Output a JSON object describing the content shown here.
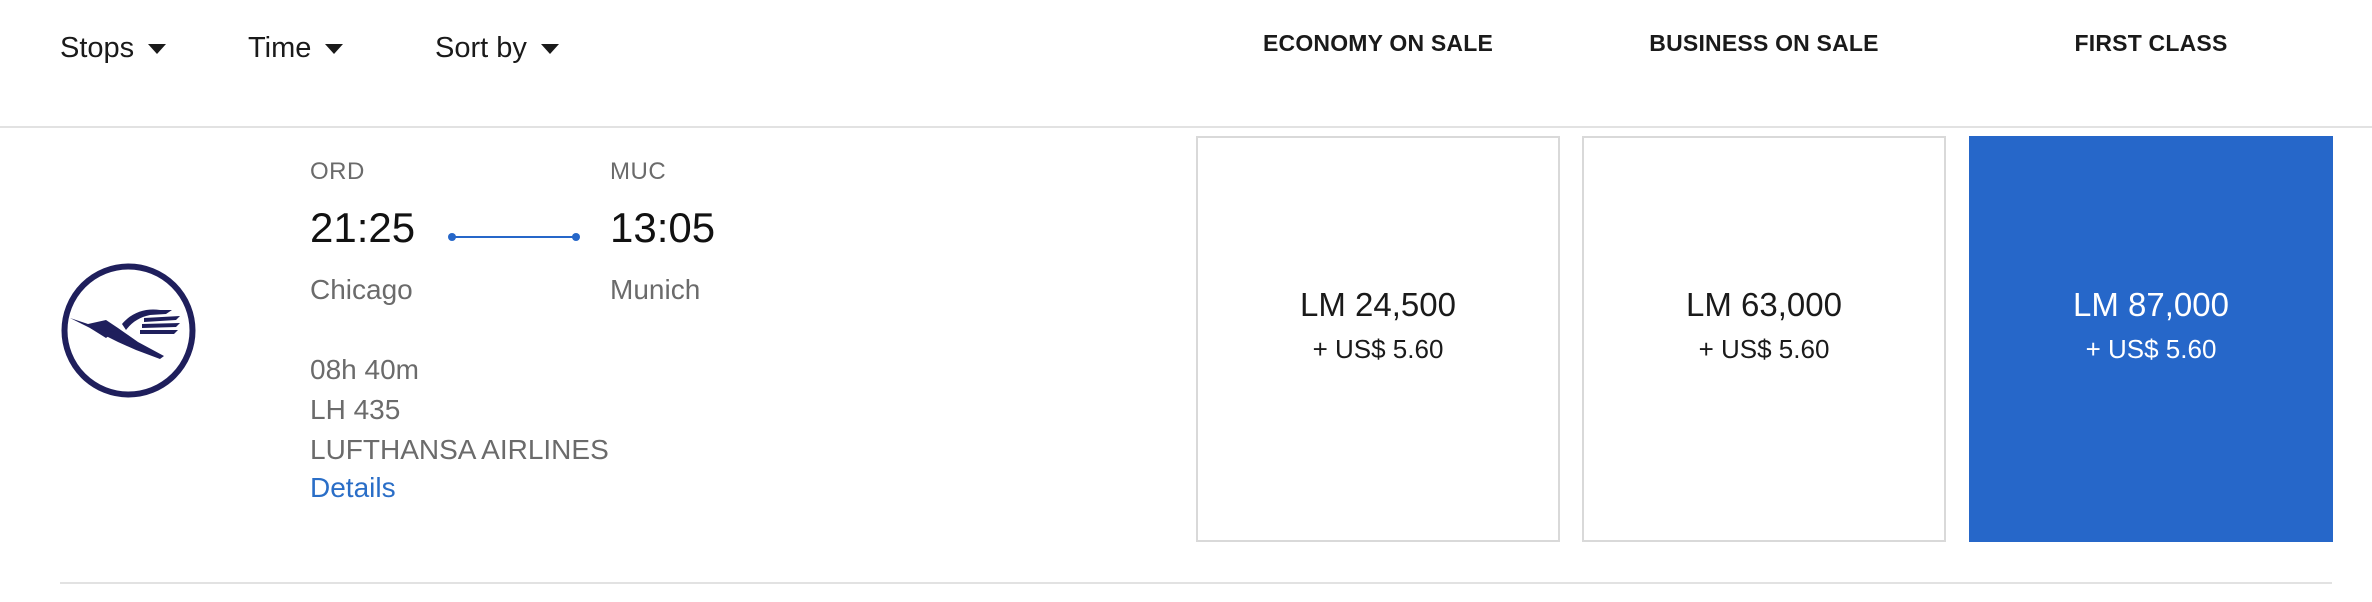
{
  "filters": {
    "stops": "Stops",
    "time": "Time",
    "sort_by": "Sort by"
  },
  "columns": {
    "economy": "ECONOMY ON SALE",
    "business": "BUSINESS ON SALE",
    "first": "FIRST CLASS"
  },
  "flight": {
    "airline_logo": "lufthansa-crane-icon",
    "origin": {
      "code": "ORD",
      "time": "21:25",
      "city": "Chicago"
    },
    "destination": {
      "code": "MUC",
      "time": "13:05",
      "city": "Munich"
    },
    "duration": "08h 40m",
    "flight_number": "LH 435",
    "airline": "LUFTHANSA AIRLINES",
    "details_label": "Details"
  },
  "fares": {
    "economy": {
      "price": "LM 24,500",
      "tax": "+ US$ 5.60"
    },
    "business": {
      "price": "LM 63,000",
      "tax": "+ US$ 5.60"
    },
    "first": {
      "price": "LM 87,000",
      "tax": "+ US$ 5.60",
      "selected": true
    }
  },
  "colors": {
    "accent": "#2667c9",
    "link": "#2a6ec7",
    "logo": "#1f1f5c"
  }
}
